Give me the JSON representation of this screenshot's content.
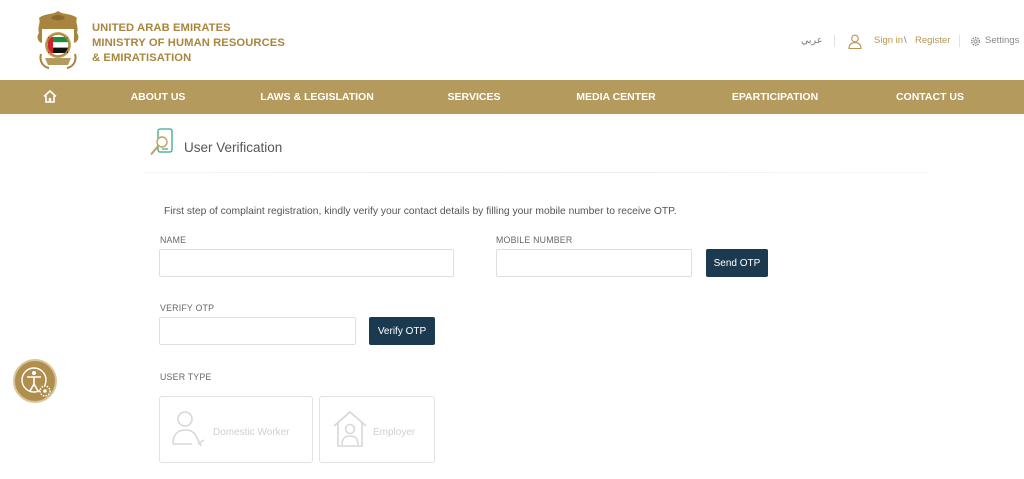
{
  "header": {
    "ministry_lines": [
      "UNITED ARAB EMIRATES",
      "MINISTRY OF HUMAN RESOURCES",
      "& EMIRATISATION"
    ],
    "language_toggle": "عربي",
    "sign_in": "Sign in",
    "slash": "\\",
    "register": "Register",
    "settings": "Settings"
  },
  "nav": {
    "items": [
      "ABOUT US",
      "LAWS & LEGISLATION",
      "SERVICES",
      "MEDIA CENTER",
      "EPARTICIPATION",
      "CONTACT US"
    ],
    "icon": "home-icon"
  },
  "page": {
    "title": "User Verification",
    "intro": "First step of complaint registration, kindly verify your contact details by filling your mobile number to receive OTP."
  },
  "form": {
    "name_label": "NAME",
    "name_value": "",
    "mobile_label": "MOBILE NUMBER",
    "mobile_value": "",
    "send_otp": "Send OTP",
    "verify_otp_label": "VERIFY OTP",
    "verify_otp_value": "",
    "verify_otp_button": "Verify OTP",
    "user_type_label": "USER TYPE",
    "user_types": [
      "Domestic Worker",
      "Employer"
    ]
  },
  "colors": {
    "gold": "#b49a5c",
    "gold_text": "#a8863e",
    "button_navy": "#1c3a4f"
  }
}
